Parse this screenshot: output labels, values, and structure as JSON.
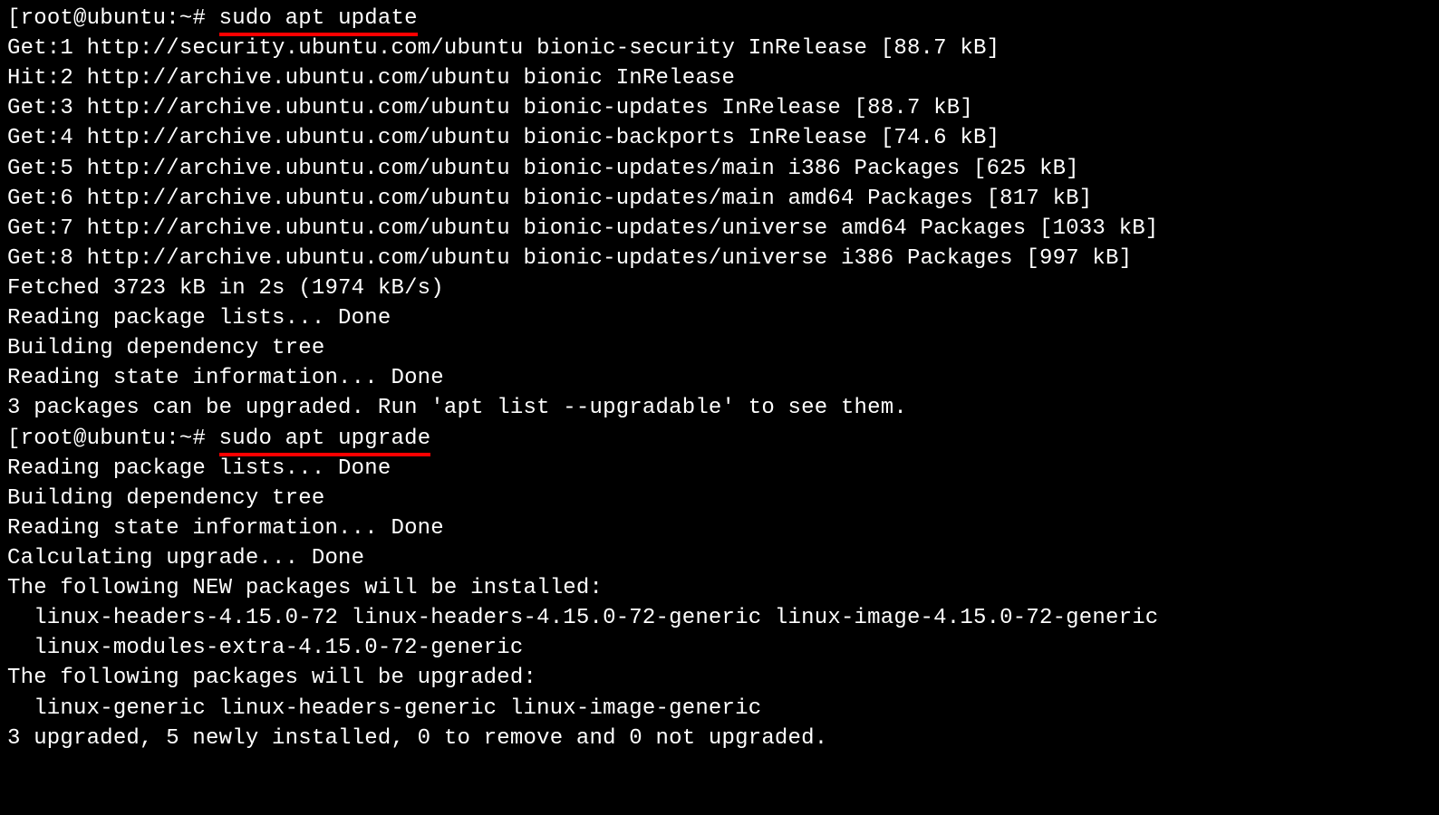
{
  "terminal": {
    "bracket_open": "[",
    "prompt1": "root@ubuntu:~# ",
    "command1": "sudo apt update",
    "output1": [
      "Get:1 http://security.ubuntu.com/ubuntu bionic-security InRelease [88.7 kB]",
      "Hit:2 http://archive.ubuntu.com/ubuntu bionic InRelease",
      "Get:3 http://archive.ubuntu.com/ubuntu bionic-updates InRelease [88.7 kB]",
      "Get:4 http://archive.ubuntu.com/ubuntu bionic-backports InRelease [74.6 kB]",
      "Get:5 http://archive.ubuntu.com/ubuntu bionic-updates/main i386 Packages [625 kB]",
      "Get:6 http://archive.ubuntu.com/ubuntu bionic-updates/main amd64 Packages [817 kB]",
      "Get:7 http://archive.ubuntu.com/ubuntu bionic-updates/universe amd64 Packages [1033 kB]",
      "Get:8 http://archive.ubuntu.com/ubuntu bionic-updates/universe i386 Packages [997 kB]",
      "Fetched 3723 kB in 2s (1974 kB/s)",
      "Reading package lists... Done",
      "Building dependency tree",
      "Reading state information... Done",
      "3 packages can be upgraded. Run 'apt list --upgradable' to see them."
    ],
    "prompt2": "root@ubuntu:~# ",
    "command2": "sudo apt upgrade",
    "output2": [
      "Reading package lists... Done",
      "Building dependency tree",
      "Reading state information... Done",
      "Calculating upgrade... Done",
      "The following NEW packages will be installed:",
      "  linux-headers-4.15.0-72 linux-headers-4.15.0-72-generic linux-image-4.15.0-72-generic",
      "  linux-modules-extra-4.15.0-72-generic",
      "The following packages will be upgraded:",
      "  linux-generic linux-headers-generic linux-image-generic",
      "3 upgraded, 5 newly installed, 0 to remove and 0 not upgraded."
    ]
  }
}
